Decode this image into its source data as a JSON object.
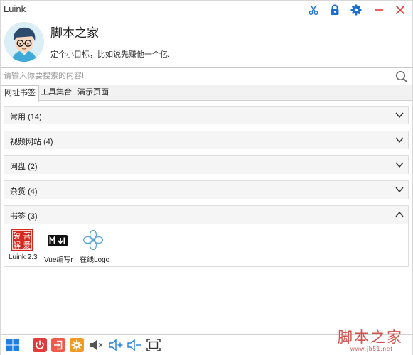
{
  "window": {
    "title": "Luink"
  },
  "toolbar": {
    "icons": [
      "scissors-icon",
      "lock-icon",
      "gear-icon",
      "minimize-icon",
      "close-icon"
    ],
    "accent": "#1a6fd1",
    "close_color": "#e53935"
  },
  "profile": {
    "name": "脚本之家",
    "motto": "定个小目标，比如说先赚他一个亿."
  },
  "search": {
    "placeholder": "请输入你要搜索的内容!",
    "value": ""
  },
  "tabs": [
    {
      "label": "网址书签",
      "active": true
    },
    {
      "label": "工具集合",
      "active": false
    },
    {
      "label": "演示页面",
      "active": false
    }
  ],
  "groups": [
    {
      "label": "常用",
      "count": "(14)",
      "expanded": false
    },
    {
      "label": "视频网站",
      "count": "(4)",
      "expanded": false
    },
    {
      "label": "网盘",
      "count": "(2)",
      "expanded": false
    },
    {
      "label": "杂货",
      "count": "(4)",
      "expanded": false
    },
    {
      "label": "书签",
      "count": "(3)",
      "expanded": true,
      "items": [
        {
          "label": "Luink 2.3",
          "icon": "seal-logo-icon",
          "icon_text": [
            "破",
            "吾",
            "解",
            "爱"
          ]
        },
        {
          "label": "Vue编写r",
          "icon": "markdown-icon"
        },
        {
          "label": "在线Logo",
          "icon": "flower-logo-icon"
        }
      ]
    }
  ],
  "bottombar": {
    "icons": [
      "windows-start-icon",
      "power-icon",
      "logout-icon",
      "settings-sun-icon",
      "mute-icon",
      "volume-up-icon",
      "volume-down-icon",
      "screenshot-icon"
    ],
    "accent_blue": "#1f7fe0",
    "accent_red": "#e23b3b",
    "accent_orange": "#f39a1e"
  },
  "watermark": {
    "main": "脚本之家",
    "sub": "www.jb51.net"
  }
}
